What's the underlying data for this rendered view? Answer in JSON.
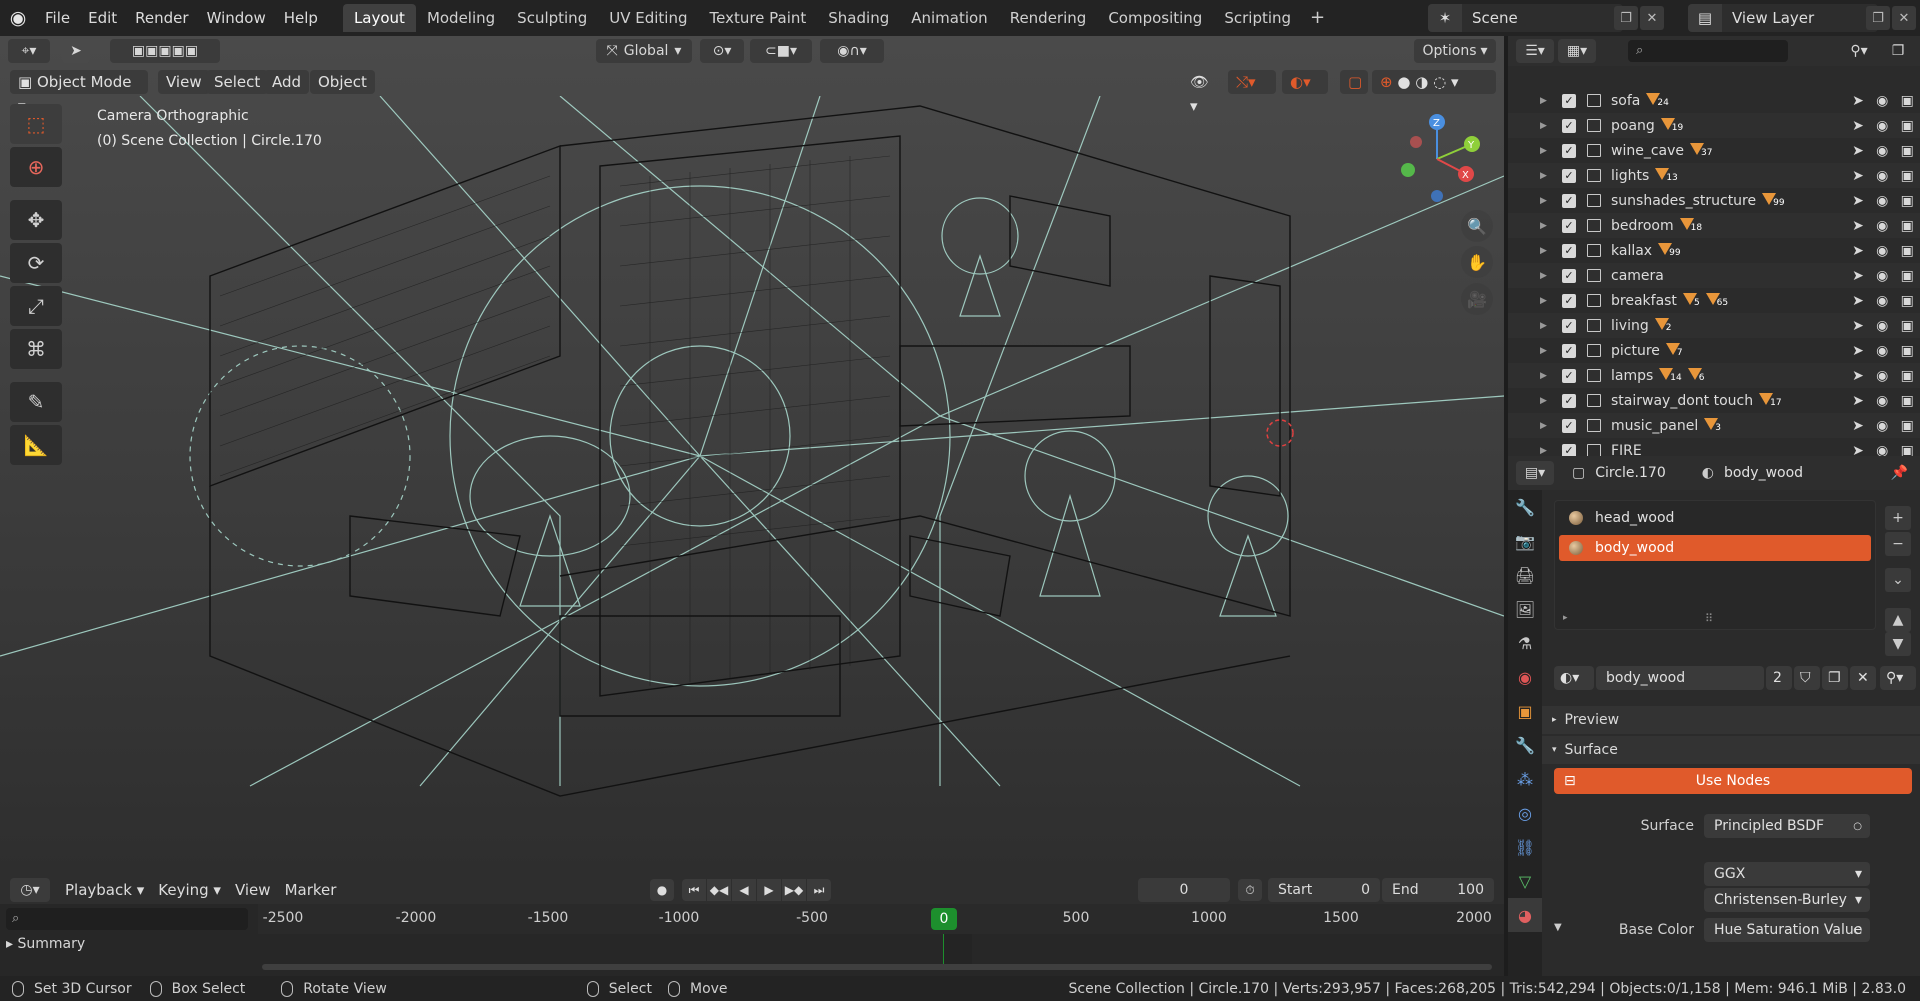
{
  "topbar": {
    "menus": [
      "File",
      "Edit",
      "Render",
      "Window",
      "Help"
    ],
    "workspaces": [
      "Layout",
      "Modeling",
      "Sculpting",
      "UV Editing",
      "Texture Paint",
      "Shading",
      "Animation",
      "Rendering",
      "Compositing",
      "Scripting"
    ],
    "active_workspace": "Layout",
    "add_workspace": "+",
    "scene": "Scene",
    "view_layer": "View Layer"
  },
  "viewport": {
    "transform_orientation": "Global",
    "options": "Options",
    "mode": "Object Mode",
    "menus": [
      "View",
      "Select",
      "Add",
      "Object"
    ],
    "camera_label": "Camera Orthographic",
    "collection_label": "(0) Scene Collection | Circle.170",
    "accent": "#e05a2b"
  },
  "outliner": {
    "rows": [
      {
        "name": "sofa",
        "count": "24"
      },
      {
        "name": "poang",
        "count": "19"
      },
      {
        "name": "wine_cave",
        "count": "37"
      },
      {
        "name": "lights",
        "count": "13"
      },
      {
        "name": "sunshades_structure",
        "count": "99"
      },
      {
        "name": "bedroom",
        "count": "18"
      },
      {
        "name": "kallax",
        "count": "99"
      },
      {
        "name": "camera",
        "count": ""
      },
      {
        "name": "breakfast",
        "count": "65",
        "extra": "5"
      },
      {
        "name": "living",
        "count": "2"
      },
      {
        "name": "picture",
        "count": "7"
      },
      {
        "name": "lamps",
        "count": "6",
        "extra": "14"
      },
      {
        "name": "stairway_dont touch",
        "count": "17"
      },
      {
        "name": "music_panel",
        "count": "3"
      },
      {
        "name": "FIRE",
        "count": ""
      }
    ]
  },
  "properties": {
    "object": "Circle.170",
    "material": "body_wood",
    "slots": [
      "head_wood",
      "body_wood"
    ],
    "selected_slot": "body_wood",
    "material_field": "body_wood",
    "user_count": "2",
    "panels": {
      "preview": "Preview",
      "surface": "Surface"
    },
    "use_nodes": "Use Nodes",
    "surface_label": "Surface",
    "surface_value": "Principled BSDF",
    "distribution": "GGX",
    "subsurface": "Christensen-Burley",
    "base_color_label": "Base Color",
    "base_color_value": "Hue Saturation Value"
  },
  "timeline": {
    "menus": [
      "Playback",
      "Keying",
      "View",
      "Marker"
    ],
    "current_frame": "0",
    "start_label": "Start",
    "start": "0",
    "end_label": "End",
    "end": "100",
    "ticks": [
      "-2500",
      "-2000",
      "-1500",
      "-1000",
      "-500",
      "0",
      "500",
      "1000",
      "1500",
      "2000"
    ],
    "cursor": "0",
    "summary": "Summary"
  },
  "statusbar": {
    "set_cursor": "Set 3D Cursor",
    "box_select": "Box Select",
    "rotate_view": "Rotate View",
    "select": "Select",
    "move": "Move",
    "stats": "Scene Collection | Circle.170 | Verts:293,957 | Faces:268,205 | Tris:542,294 | Objects:0/1,158 | Mem: 946.1 MiB | 2.83.0"
  }
}
